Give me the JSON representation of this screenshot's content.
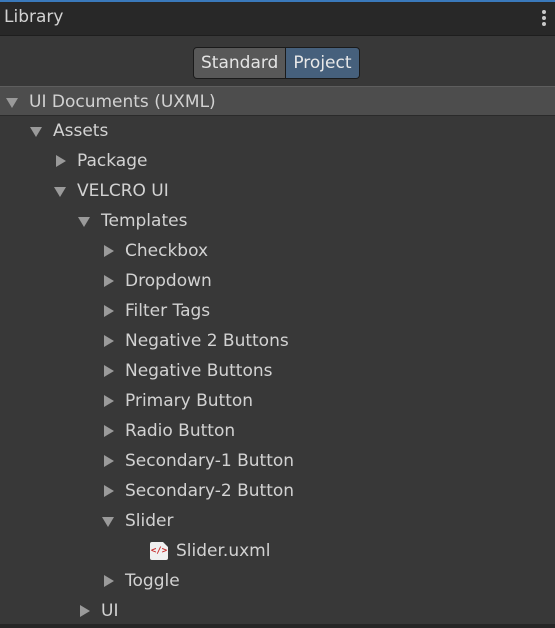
{
  "panel": {
    "title": "Library",
    "menu_icon": "kebab-menu-icon"
  },
  "toggle": {
    "standard_label": "Standard",
    "project_label": "Project",
    "selected": "Project"
  },
  "tree": {
    "header": {
      "label": "UI Documents (UXML)",
      "expanded": true
    },
    "items": [
      {
        "label": "Assets",
        "expanded": true
      },
      {
        "label": "Package",
        "expanded": false
      },
      {
        "label": "VELCRO UI",
        "expanded": true
      },
      {
        "label": "Templates",
        "expanded": true
      },
      {
        "label": "Checkbox",
        "expanded": false
      },
      {
        "label": "Dropdown",
        "expanded": false
      },
      {
        "label": "Filter Tags",
        "expanded": false
      },
      {
        "label": "Negative 2 Buttons",
        "expanded": false
      },
      {
        "label": "Negative Buttons",
        "expanded": false
      },
      {
        "label": "Primary Button",
        "expanded": false
      },
      {
        "label": "Radio Button",
        "expanded": false
      },
      {
        "label": "Secondary-1 Button",
        "expanded": false
      },
      {
        "label": "Secondary-2 Button",
        "expanded": false
      },
      {
        "label": "Slider",
        "expanded": true
      },
      {
        "label": "Slider.uxml",
        "icon": "uxml-file-icon"
      },
      {
        "label": "Toggle",
        "expanded": false
      },
      {
        "label": "UI",
        "expanded": false
      }
    ]
  },
  "colors": {
    "accent_line": "#3a79bb",
    "selected_toggle": "#46607c",
    "background": "#383838",
    "header_bg": "#4d4d4d"
  }
}
